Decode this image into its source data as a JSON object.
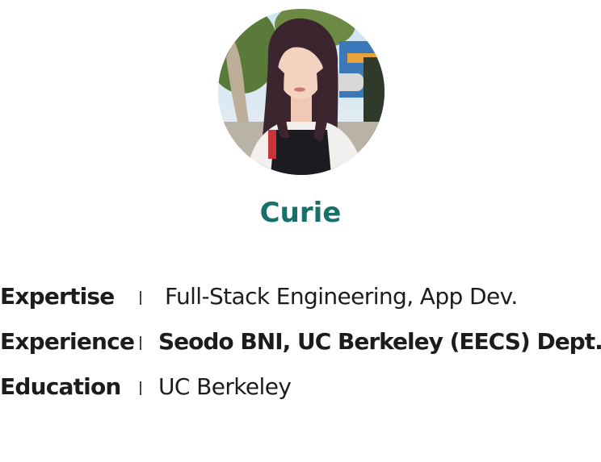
{
  "profile": {
    "name": "Curie",
    "avatar": "profile-photo",
    "accent_color": "#17706a"
  },
  "details": [
    {
      "label": "Expertise",
      "value": "Full-Stack Engineering, App Dev."
    },
    {
      "label": "Experience",
      "value": "Seodo BNI, UC Berkeley (EECS) Dept."
    },
    {
      "label": "Education",
      "value": "UC Berkeley"
    }
  ]
}
